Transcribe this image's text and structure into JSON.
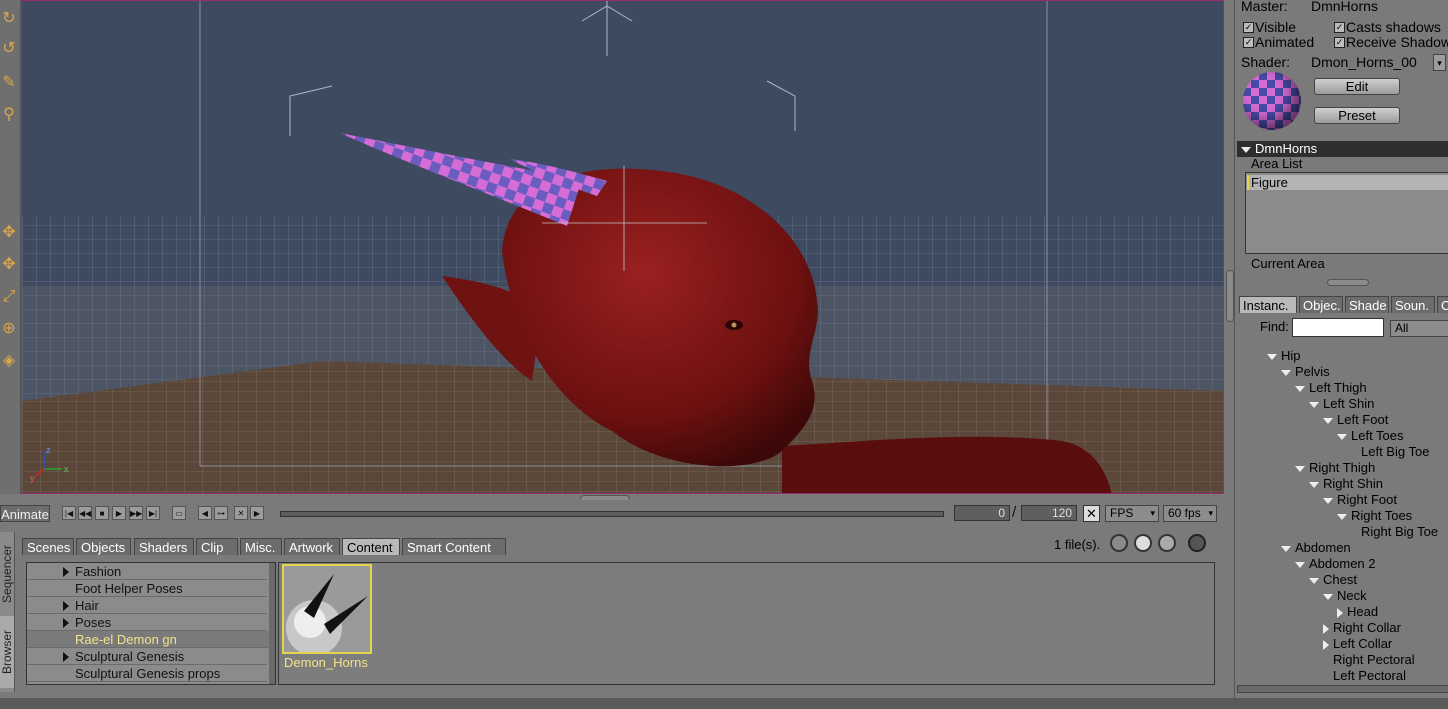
{
  "window": {
    "title": ""
  },
  "tools": [
    "rotate-icon",
    "twist-icon",
    "pencil-icon",
    "taper-icon",
    "translate-icon",
    "translate-xz-icon",
    "scale-icon",
    "universal-icon",
    "material-icon"
  ],
  "viewport": {
    "axis_labels": {
      "x": "x",
      "y": "y",
      "z": "z"
    },
    "colors": {
      "sky": "#3d4a60",
      "floor": "#4a3c30",
      "figure": "#7a1515",
      "horn_a": "#d66cd6",
      "horn_b": "#6a5dbf"
    }
  },
  "timeline": {
    "animate_label": "Animate",
    "current_frame": "0",
    "separator": "/",
    "total_frames": "120",
    "fps_mode": "FPS",
    "fps_value": "60 fps"
  },
  "browser": {
    "side_tabs": [
      "Browser",
      "Sequencer"
    ],
    "tabs": [
      "Scenes",
      "Objects",
      "Shaders",
      "Clip",
      "Misc.",
      "Artwork",
      "Content",
      "Smart Content"
    ],
    "active_tab": "Content",
    "file_count": "1 file(s).",
    "categories": [
      {
        "label": "Fashion",
        "expandable": true,
        "selected": false
      },
      {
        "label": "Foot Helper Poses",
        "expandable": false,
        "selected": false
      },
      {
        "label": "Hair",
        "expandable": true,
        "selected": false
      },
      {
        "label": "Poses",
        "expandable": true,
        "selected": false
      },
      {
        "label": "Rae-el Demon gn",
        "expandable": false,
        "selected": true
      },
      {
        "label": "Sculptural Genesis",
        "expandable": true,
        "selected": false
      },
      {
        "label": "Sculptural Genesis props",
        "expandable": false,
        "selected": false
      }
    ],
    "thumbnail": {
      "label": "Demon_Horns"
    }
  },
  "properties": {
    "master_label": "Master:",
    "master_value": "DmnHorns",
    "visible": "Visible",
    "casts_shadows": "Casts shadows",
    "animated": "Animated",
    "receive_shadow": "Receive Shadow",
    "shader_label": "Shader:",
    "shader_value": "Dmon_Horns_00",
    "edit": "Edit",
    "preset": "Preset",
    "section_title": "DmnHorns",
    "area_list_label": "Area List",
    "area_item": "Figure",
    "current_area_label": "Current Area"
  },
  "scene_tabs": [
    "Instanc.",
    "Objec.",
    "Shade.",
    "Soun.",
    "C"
  ],
  "find_label": "Find:",
  "find_value": "",
  "find_scope": "All",
  "tree": [
    {
      "label": "Hip",
      "depth": 0,
      "state": "down"
    },
    {
      "label": "Pelvis",
      "depth": 1,
      "state": "down"
    },
    {
      "label": "Left Thigh",
      "depth": 2,
      "state": "down"
    },
    {
      "label": "Left Shin",
      "depth": 3,
      "state": "down"
    },
    {
      "label": "Left Foot",
      "depth": 4,
      "state": "down"
    },
    {
      "label": "Left Toes",
      "depth": 5,
      "state": "down"
    },
    {
      "label": "Left Big Toe",
      "depth": 6,
      "state": "none"
    },
    {
      "label": "Right Thigh",
      "depth": 2,
      "state": "down"
    },
    {
      "label": "Right Shin",
      "depth": 3,
      "state": "down"
    },
    {
      "label": "Right Foot",
      "depth": 4,
      "state": "down"
    },
    {
      "label": "Right Toes",
      "depth": 5,
      "state": "down"
    },
    {
      "label": "Right Big Toe",
      "depth": 6,
      "state": "none"
    },
    {
      "label": "Abdomen",
      "depth": 1,
      "state": "down"
    },
    {
      "label": "Abdomen 2",
      "depth": 2,
      "state": "down"
    },
    {
      "label": "Chest",
      "depth": 3,
      "state": "down"
    },
    {
      "label": "Neck",
      "depth": 4,
      "state": "down"
    },
    {
      "label": "Head",
      "depth": 5,
      "state": "right"
    },
    {
      "label": "Right Collar",
      "depth": 4,
      "state": "right"
    },
    {
      "label": "Left Collar",
      "depth": 4,
      "state": "right"
    },
    {
      "label": "Right Pectoral",
      "depth": 4,
      "state": "none"
    },
    {
      "label": "Left Pectoral",
      "depth": 4,
      "state": "none"
    }
  ]
}
